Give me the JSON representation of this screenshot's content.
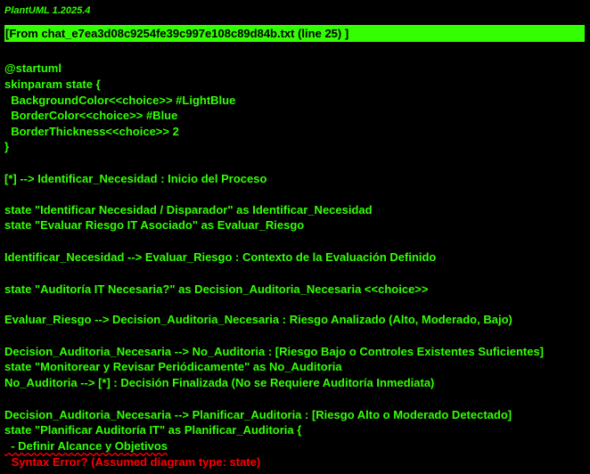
{
  "version": "PlantUML 1.2025.4",
  "header": "[From chat_e7ea3d08c9254fe39c997e108c89d84b.txt (line 25) ]",
  "lines": {
    "l01": "@startuml",
    "l02": "skinparam state {",
    "l03": "  BackgroundColor<<choice>> #LightBlue",
    "l04": "  BorderColor<<choice>> #Blue",
    "l05": "  BorderThickness<<choice>> 2",
    "l06": "}",
    "l07": "[*] --> Identificar_Necesidad : Inicio del Proceso",
    "l08": "state \"Identificar Necesidad / Disparador\" as Identificar_Necesidad",
    "l09": "state \"Evaluar Riesgo IT Asociado\" as Evaluar_Riesgo",
    "l10": "Identificar_Necesidad --> Evaluar_Riesgo : Contexto de la Evaluación Definido",
    "l11": "state \"Auditoría IT Necesaria?\" as Decision_Auditoria_Necesaria <<choice>>",
    "l12": "Evaluar_Riesgo --> Decision_Auditoria_Necesaria : Riesgo Analizado (Alto, Moderado, Bajo)",
    "l13": "Decision_Auditoria_Necesaria --> No_Auditoria : [Riesgo Bajo o Controles Existentes Suficientes]",
    "l14": "state \"Monitorear y Revisar Periódicamente\" as No_Auditoria",
    "l15": "No_Auditoria --> [*] : Decisión Finalizada (No se Requiere Auditoría Inmediata)",
    "l16": "Decision_Auditoria_Necesaria --> Planificar_Auditoria : [Riesgo Alto o Moderado Detectado]",
    "l17": "state \"Planificar Auditoría IT\" as Planificar_Auditoria {",
    "l18": "  - Definir Alcance y Objetivos"
  },
  "error": " Syntax Error? (Assumed diagram type: state)",
  "colors": {
    "text": "#33ff02",
    "header_background": "#33ff02",
    "background": "#000000",
    "error": "#ff0000"
  }
}
